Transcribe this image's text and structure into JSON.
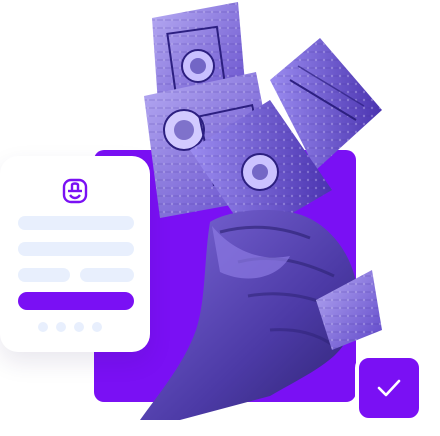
{
  "colors": {
    "accent": "#7a10f4",
    "card_background": "#ffffff",
    "placeholder_bar": "#e8effd",
    "photo_tint": "#6a4fd6"
  },
  "ui_card": {
    "logo_icon": "stacked-coins-logo-icon",
    "placeholder_bars": 4,
    "page_dots": 4
  },
  "photo": {
    "subject": "hand-holding-banknotes"
  },
  "badge": {
    "icon": "checkmark-icon"
  }
}
